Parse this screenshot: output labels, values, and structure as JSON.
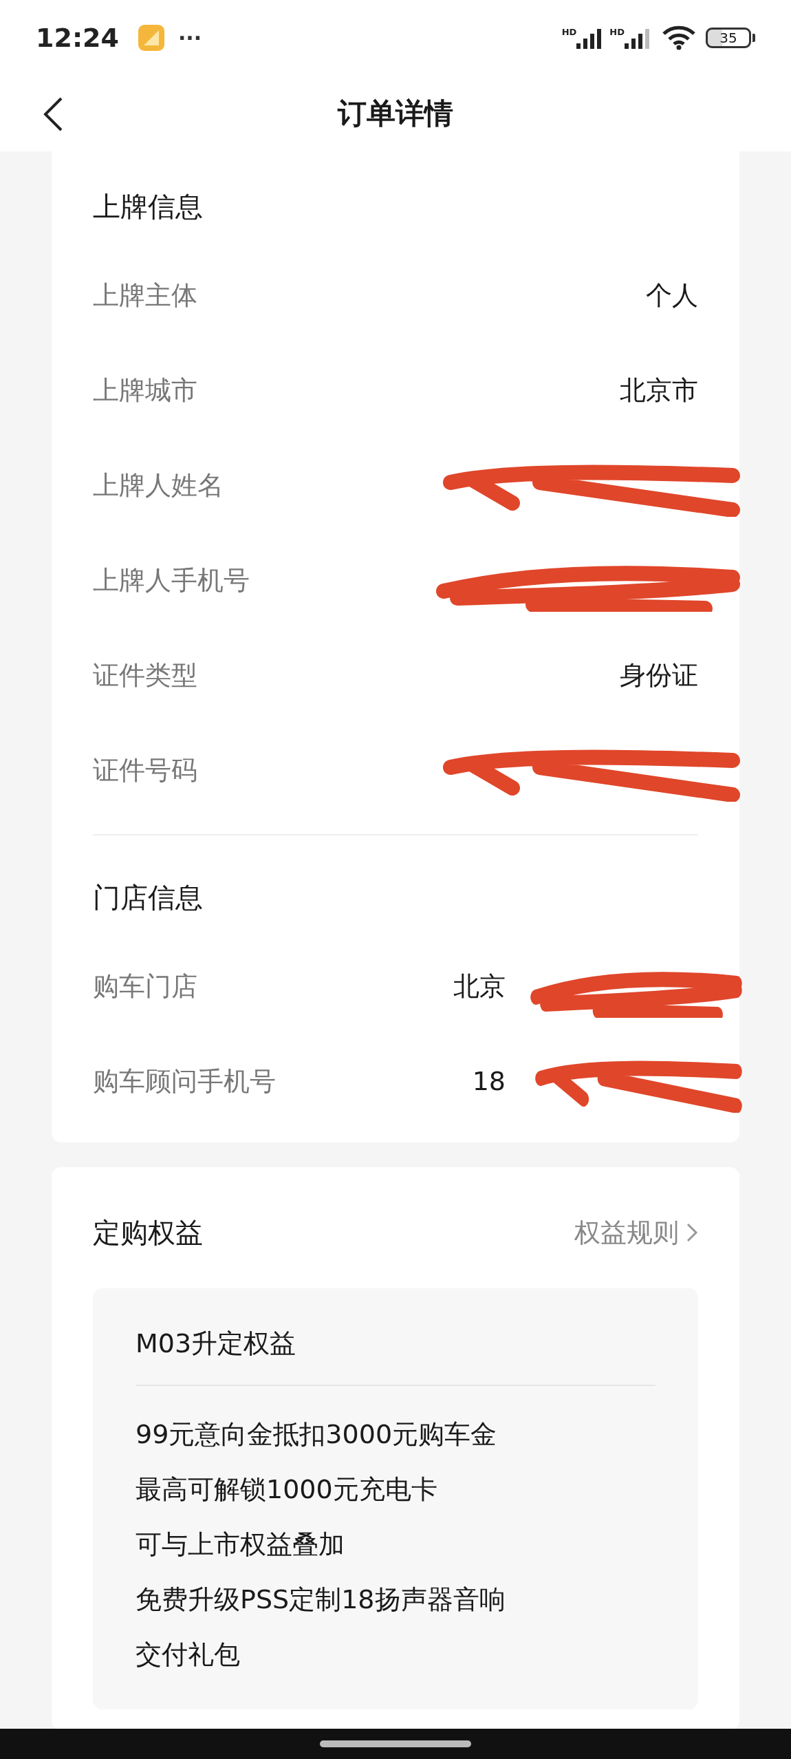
{
  "status_bar": {
    "time": "12:24",
    "more": "···",
    "signal_labels": [
      "HD",
      "HD"
    ],
    "battery": "35"
  },
  "header": {
    "title": "订单详情"
  },
  "sections": [
    {
      "title": "上牌信息",
      "rows": [
        {
          "label": "上牌主体",
          "value": "个人",
          "redacted": false
        },
        {
          "label": "上牌城市",
          "value": "北京市",
          "redacted": false
        },
        {
          "label": "上牌人姓名",
          "redacted": true
        },
        {
          "label": "上牌人手机号",
          "redacted": true
        },
        {
          "label": "证件类型",
          "value": "身份证",
          "redacted": false
        },
        {
          "label": "证件号码",
          "redacted": true
        }
      ]
    },
    {
      "title": "门店信息",
      "rows": [
        {
          "label": "购车门店",
          "value": "北京",
          "redacted": true
        },
        {
          "label": "购车顾问手机号",
          "value": "18",
          "redacted": true
        }
      ]
    }
  ],
  "benefits": {
    "title": "定购权益",
    "link": "权益规则",
    "box_title": "M03升定权益",
    "lines": [
      "99元意向金抵扣3000元购车金",
      "最高可解锁1000元充电卡",
      "可与上市权益叠加",
      "免费升级PSS定制18扬声器音响",
      "交付礼包"
    ]
  }
}
